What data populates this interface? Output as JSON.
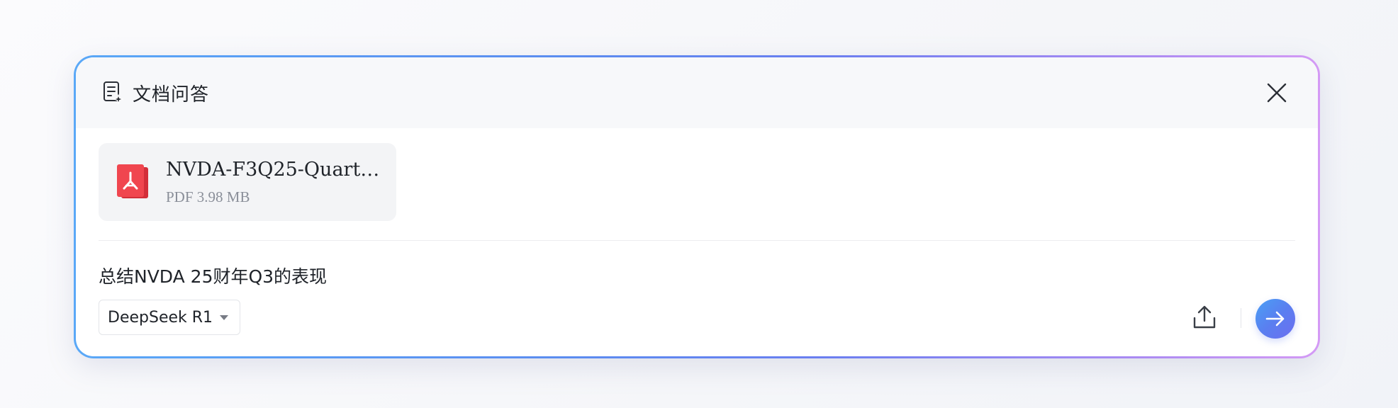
{
  "header": {
    "title": "文档问答",
    "icon": "document-ai-icon",
    "close_icon": "close-icon"
  },
  "file": {
    "name": "NVDA-F3Q25-Quart…",
    "meta": "PDF 3.98 MB",
    "icon": "pdf-file-icon",
    "icon_color": "#f0464f"
  },
  "query": {
    "text": "总结NVDA 25财年Q3的表现"
  },
  "model_select": {
    "value": "DeepSeek R1",
    "icon": "caret-down-icon"
  },
  "actions": {
    "upload_icon": "upload-icon",
    "send_icon": "arrow-right-icon"
  },
  "colors": {
    "border_gradient_start": "#5aa8f7",
    "border_gradient_end": "#d49af5",
    "send_button": "#5a7ff0"
  }
}
